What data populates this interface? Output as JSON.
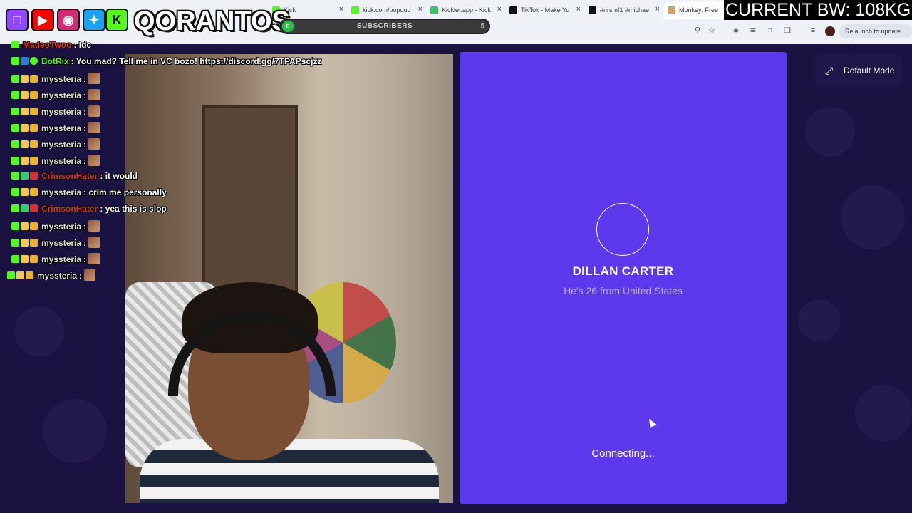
{
  "browser": {
    "tabs": [
      {
        "label": "Kick",
        "color": "#53fc18"
      },
      {
        "label": "kick.com/popout/",
        "color": "#53fc18"
      },
      {
        "label": "Kicklet.app - Kick",
        "color": "#3fbf6b"
      },
      {
        "label": "TikTok - Make Yo",
        "color": "#111111"
      },
      {
        "label": "#nrsmf1 #michae",
        "color": "#111111"
      },
      {
        "label": "Monkey: Free",
        "color": "#caa16a"
      }
    ],
    "relaunch_label": "Relaunch to update"
  },
  "overlay": {
    "brand_name": "QORANTOS",
    "subscribers_label": "SUBSCRIBERS",
    "subscribers_count": "0",
    "subscribers_goal": "5",
    "subscribers_progress": 0.0,
    "bandwidth_text": "CURRENT BW: 108KG"
  },
  "chat": {
    "messages": [
      {
        "user": "MadeoTwoo",
        "text": ": Idc",
        "user_color": "#e02a2a",
        "emote": false
      },
      {
        "user": "BotRix",
        "text": ": You mad? Tell me in VC bozo! https://discord.gg/7TPAPscjzz",
        "user_color": "#53fc18",
        "emote": false
      },
      {
        "user": "myssteria",
        "text": ":",
        "user_color": "#dcdcdc",
        "emote": true
      },
      {
        "user": "myssteria",
        "text": ":",
        "user_color": "#dcdcdc",
        "emote": true
      },
      {
        "user": "myssteria",
        "text": ":",
        "user_color": "#dcdcdc",
        "emote": true
      },
      {
        "user": "myssteria",
        "text": ":",
        "user_color": "#dcdcdc",
        "emote": true
      },
      {
        "user": "myssteria",
        "text": ":",
        "user_color": "#dcdcdc",
        "emote": true
      },
      {
        "user": "myssteria",
        "text": ":",
        "user_color": "#dcdcdc",
        "emote": true
      },
      {
        "user": "CrimsonHater",
        "text": ": it would",
        "user_color": "#e02a2a",
        "emote": false
      },
      {
        "user": "myssteria",
        "text": ": crim me personally",
        "user_color": "#dcdcdc",
        "emote": false
      },
      {
        "user": "CrimsonHater",
        "text": ": yea this is slop",
        "user_color": "#e02a2a",
        "emote": false
      },
      {
        "user": "myssteria",
        "text": ":",
        "user_color": "#dcdcdc",
        "emote": true
      },
      {
        "user": "myssteria",
        "text": ":",
        "user_color": "#dcdcdc",
        "emote": true
      },
      {
        "user": "myssteria",
        "text": ":",
        "user_color": "#dcdcdc",
        "emote": true
      },
      {
        "user": "myssteria",
        "text": ":",
        "user_color": "#dcdcdc",
        "emote": true
      }
    ]
  },
  "match": {
    "name": "DILLAN CARTER",
    "subtitle": "He's 26 from United States",
    "status": "Connecting..."
  },
  "mode_button": {
    "label": "Default Mode"
  },
  "colors": {
    "panel_purple": "#5c39ec",
    "page_bg": "#1a1240"
  }
}
